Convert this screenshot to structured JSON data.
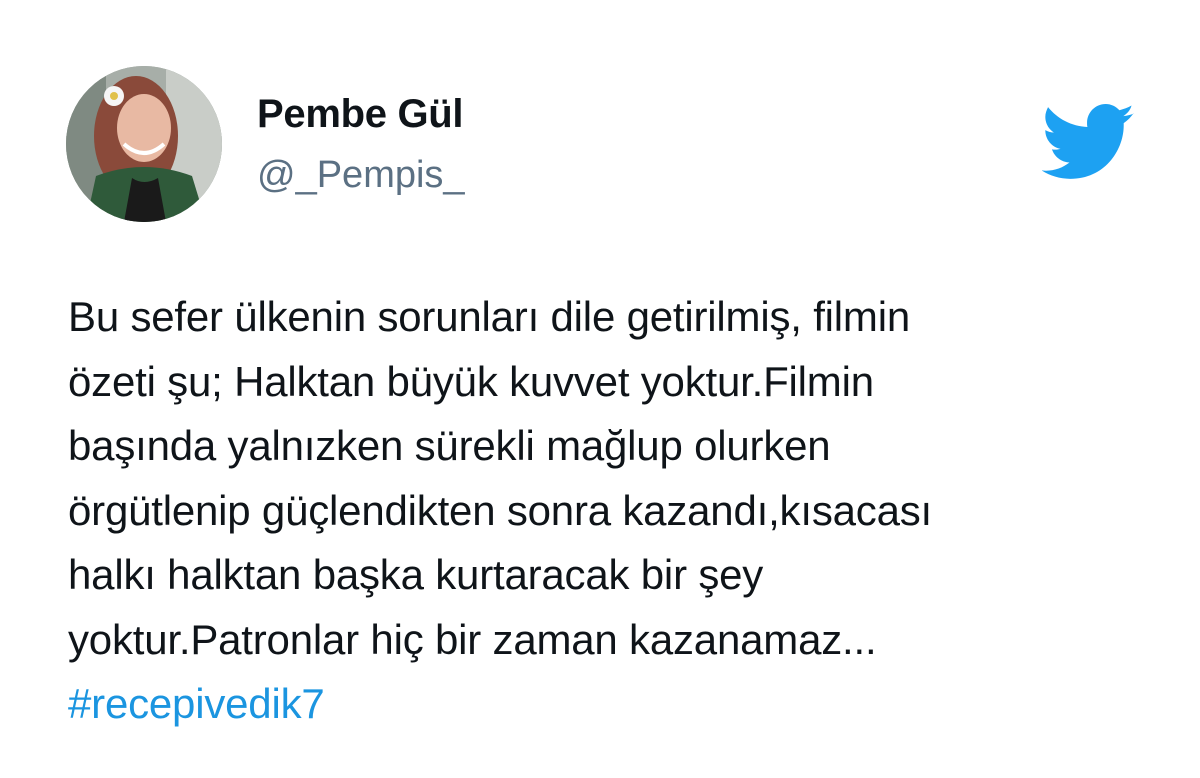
{
  "author": {
    "display_name": "Pembe Gül",
    "handle": "@_Pempis_"
  },
  "brand": {
    "logo_icon": "twitter-bird-icon",
    "accent_color": "#1da1f2"
  },
  "tweet": {
    "lines": [
      "Bu sefer ülkenin sorunları dile getirilmiş, filmin",
      "özeti şu; Halktan büyük kuvvet yoktur.Filmin",
      "başında yalnızken sürekli mağlup olurken",
      "örgütlenip güçlendikten sonra kazandı,kısacası",
      "halkı halktan başka kurtaracak bir şey",
      "yoktur.Patronlar hiç bir zaman kazanamaz..."
    ],
    "hashtag": "#recepivedik7",
    "hashtag_color": "#1b95e0"
  }
}
